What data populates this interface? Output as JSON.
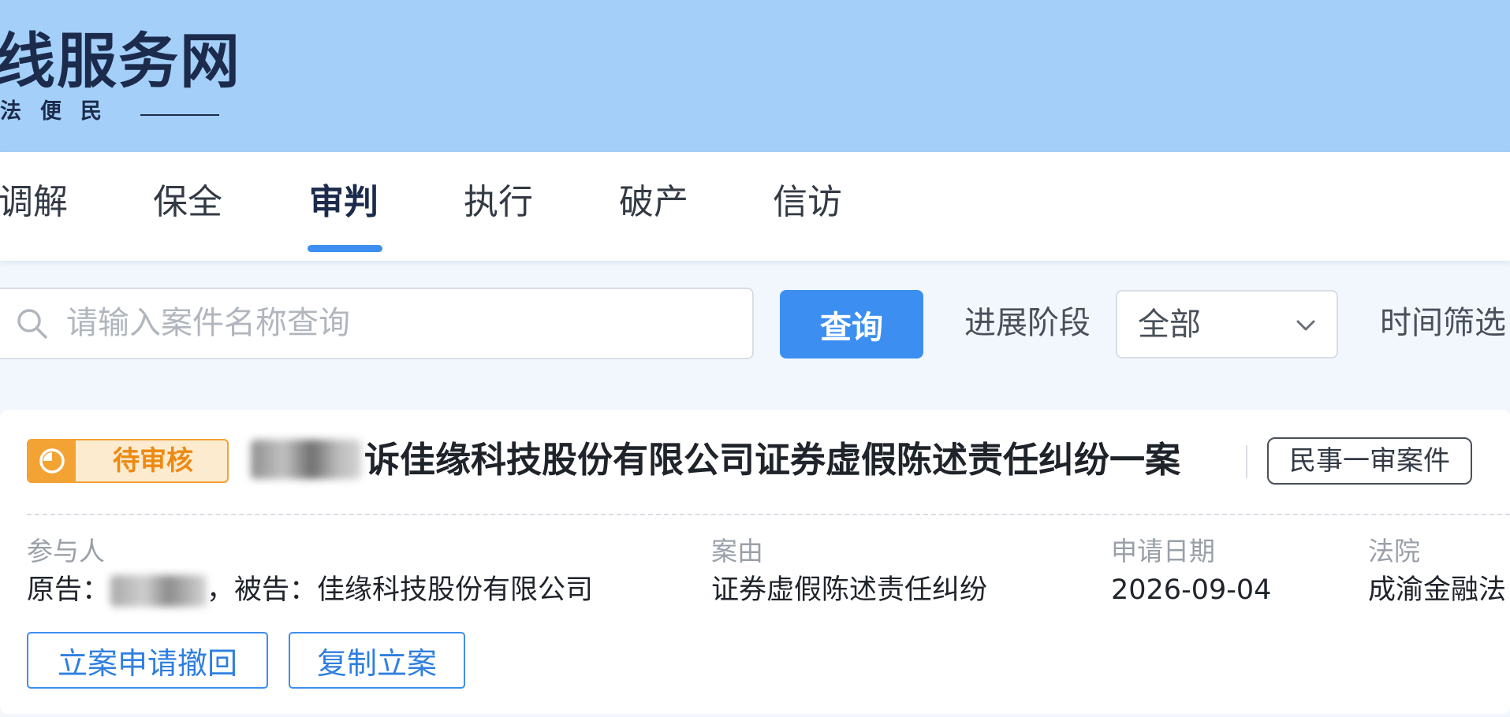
{
  "header": {
    "site_title": "线服务网",
    "site_slogan": "法便民"
  },
  "tabs": [
    {
      "label": "调解"
    },
    {
      "label": "保全"
    },
    {
      "label": "审判"
    },
    {
      "label": "执行"
    },
    {
      "label": "破产"
    },
    {
      "label": "信访"
    }
  ],
  "active_tab": "审判",
  "search": {
    "placeholder": "请输入案件名称查询",
    "value": "",
    "button_label": "查询"
  },
  "filters": {
    "stage_label": "进展阶段",
    "stage_value": "全部",
    "time_label": "时间筛选"
  },
  "case": {
    "status": "待审核",
    "title": "诉佳缘科技股份有限公司证券虚假陈述责任纠纷一案",
    "type_tag": "民事一审案件",
    "fields": {
      "participants_label": "参与人",
      "plaintiff_prefix": "原告：",
      "defendant_text": "，被告：佳缘科技股份有限公司",
      "cause_label": "案由",
      "cause_value": "证券虚假陈述责任纠纷",
      "date_label": "申请日期",
      "date_value": "2026-09-04",
      "court_label": "法院",
      "court_value": "成渝金融法"
    },
    "actions": {
      "withdraw_label": "立案申请撤回",
      "copy_label": "复制立案"
    }
  },
  "colors": {
    "banner": "#a3cff9",
    "accent": "#3c8ff0",
    "status_orange": "#f3a234",
    "page_bg": "#f2f7fd"
  },
  "icons": [
    "search-icon",
    "chevron-down-icon",
    "pending-status-icon"
  ]
}
